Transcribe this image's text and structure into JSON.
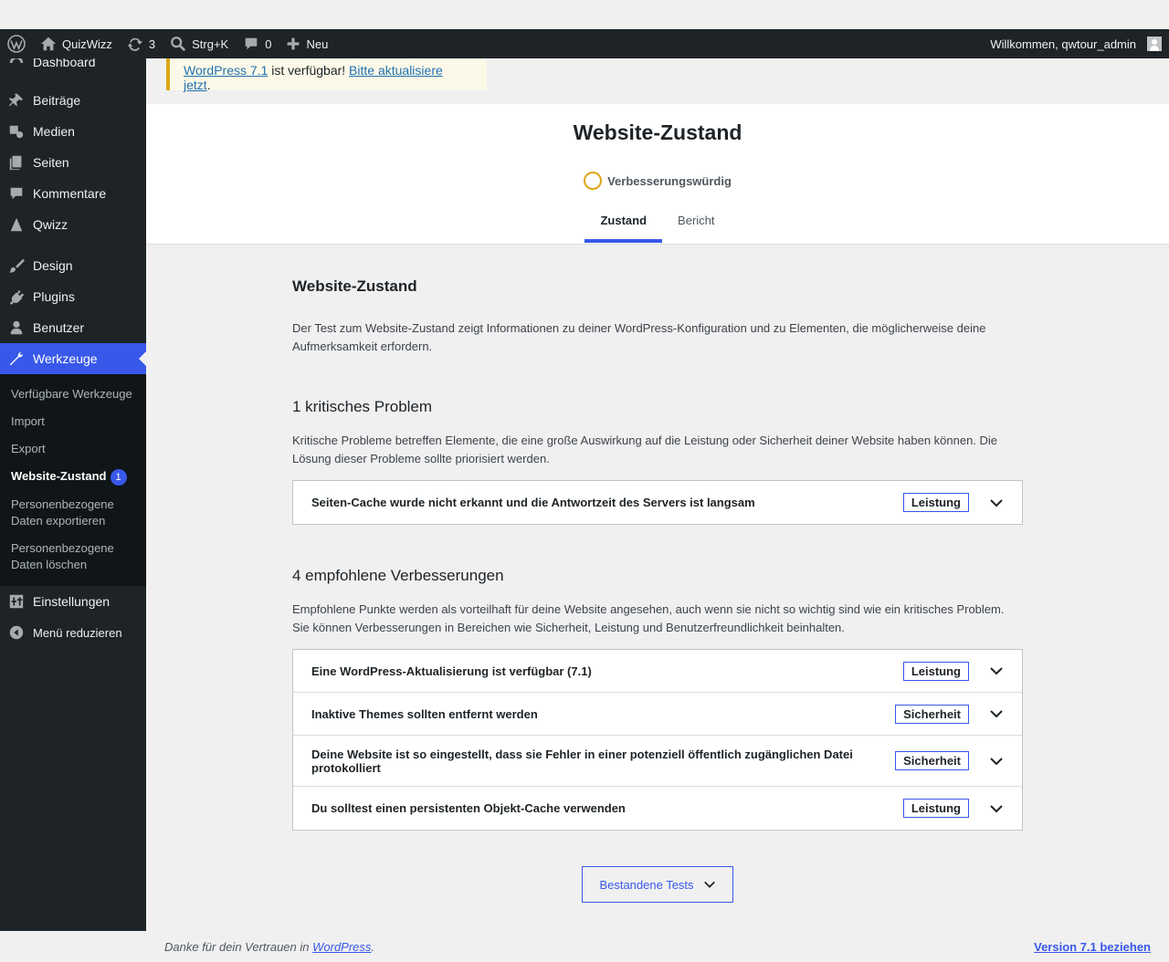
{
  "adminbar": {
    "site_name": "QuizWizz",
    "updates_count": "3",
    "search_label": "Strg+K",
    "comments_count": "0",
    "new_label": "Neu",
    "greeting": "Willkommen, qwtour_admin"
  },
  "sidebar": {
    "items": [
      {
        "label": "Dashboard",
        "icon": "dashboard-icon"
      },
      {
        "label": "Beiträge",
        "icon": "pin-icon"
      },
      {
        "label": "Medien",
        "icon": "media-icon"
      },
      {
        "label": "Seiten",
        "icon": "pages-icon"
      },
      {
        "label": "Kommentare",
        "icon": "comment-icon"
      },
      {
        "label": "Qwizz",
        "icon": "qwizz-icon"
      },
      {
        "label": "Design",
        "icon": "brush-icon"
      },
      {
        "label": "Plugins",
        "icon": "plugin-icon"
      },
      {
        "label": "Benutzer",
        "icon": "user-icon"
      },
      {
        "label": "Werkzeuge",
        "icon": "wrench-icon"
      },
      {
        "label": "Einstellungen",
        "icon": "settings-icon"
      },
      {
        "label": "Menü reduzieren",
        "icon": "collapse-icon"
      }
    ],
    "submenu": [
      {
        "label": "Verfügbare Werkzeuge"
      },
      {
        "label": "Import"
      },
      {
        "label": "Export"
      },
      {
        "label": "Website-Zustand",
        "badge": "1"
      },
      {
        "label": "Personenbezogene Daten exportieren"
      },
      {
        "label": "Personenbezogene Daten löschen"
      }
    ]
  },
  "notice": {
    "link1": "WordPress 7.1",
    "text": " ist verfügbar! ",
    "link2": "Bitte aktualisiere jetzt",
    "end": "."
  },
  "header": {
    "title": "Website-Zustand",
    "status": "Verbesserungswürdig",
    "tabs": [
      "Zustand",
      "Bericht"
    ]
  },
  "main": {
    "section_title": "Website-Zustand",
    "intro": "Der Test zum Website-Zustand zeigt Informationen zu deiner WordPress-Konfiguration und zu Elementen, die möglicherweise deine Aufmerksamkeit erfordern.",
    "critical": {
      "title": "1 kritisches Problem",
      "desc": "Kritische Probleme betreffen Elemente, die eine große Auswirkung auf die Leistung oder Sicherheit deiner Website haben können. Die Lösung dieser Probleme sollte priorisiert werden.",
      "items": [
        {
          "title": "Seiten-Cache wurde nicht erkannt und die Antwortzeit des Servers ist langsam",
          "badge": "Leistung"
        }
      ]
    },
    "recommended": {
      "title": "4 empfohlene Verbesserungen",
      "desc": "Empfohlene Punkte werden als vorteilhaft für deine Website angesehen, auch wenn sie nicht so wichtig sind wie ein kritisches Problem. Sie können Verbesserungen in Bereichen wie Sicherheit, Leistung und Benutzerfreundlichkeit beinhalten.",
      "items": [
        {
          "title": "Eine WordPress-Aktualisierung ist verfügbar (7.1)",
          "badge": "Leistung"
        },
        {
          "title": "Inaktive Themes sollten entfernt werden",
          "badge": "Sicherheit"
        },
        {
          "title": "Deine Website ist so eingestellt, dass sie Fehler in einer potenziell öffentlich zugänglichen Datei protokolliert",
          "badge": "Sicherheit"
        },
        {
          "title": "Du solltest einen persistenten Objekt-Cache verwenden",
          "badge": "Leistung"
        }
      ]
    },
    "passed_button": "Bestandene Tests"
  },
  "footer": {
    "thanks": "Danke für dein Vertrauen in ",
    "wp_link": "WordPress",
    "end": ".",
    "version_link": "Version 7.1 beziehen"
  },
  "colors": {
    "accent": "#3858e9",
    "warning": "#dba617",
    "adminbar": "#1d2327"
  }
}
